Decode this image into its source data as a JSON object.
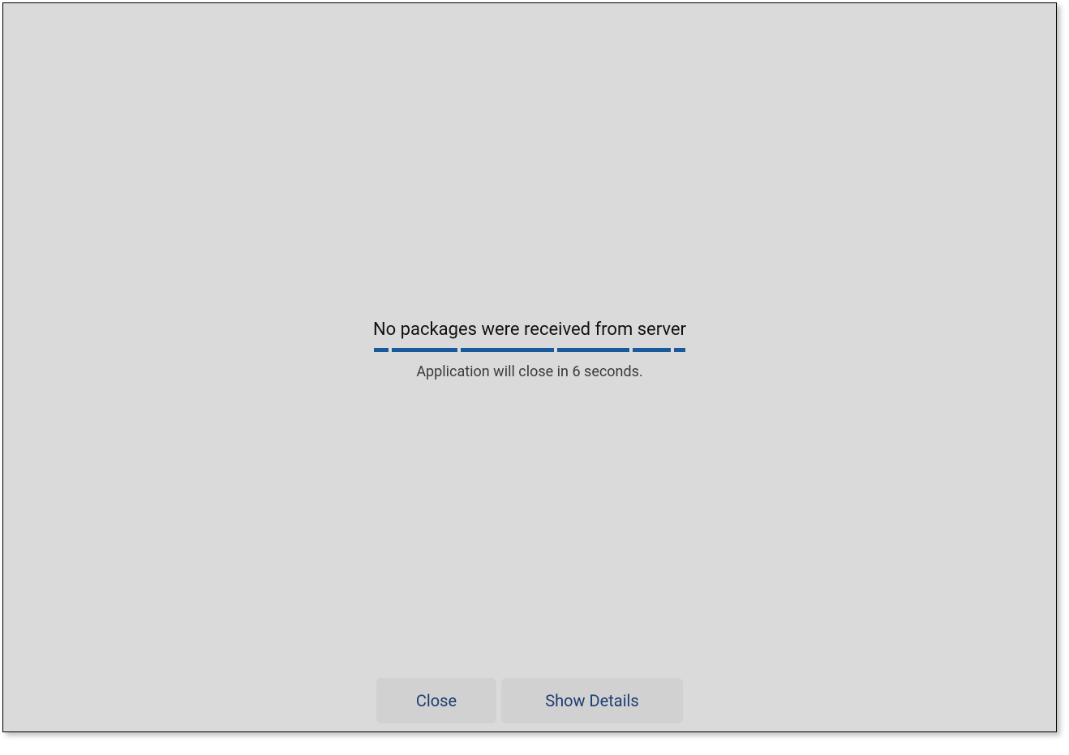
{
  "dialog": {
    "error_title": "No packages were received from server",
    "countdown_text": "Application will close in 6 seconds.",
    "countdown_seconds": 6
  },
  "buttons": {
    "close_label": "Close",
    "details_label": "Show Details"
  },
  "colors": {
    "background": "#dadada",
    "progress": "#1b5a9a",
    "button_text": "#1b3d73",
    "button_bg": "#d1d1d1"
  }
}
